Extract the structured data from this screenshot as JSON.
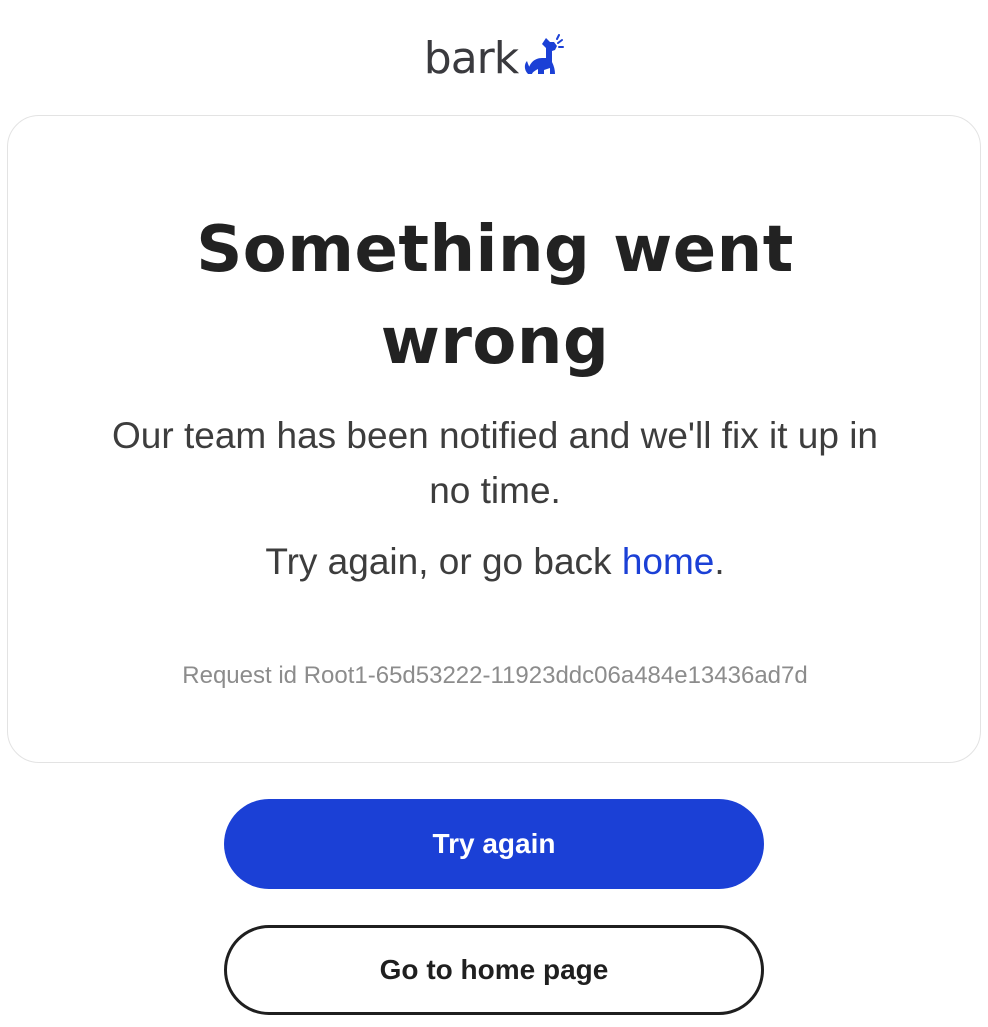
{
  "brand": {
    "name": "bark",
    "logo_icon": "dog-barking-icon",
    "word_color": "#3a3a3e",
    "icon_color": "#1b40d6"
  },
  "error": {
    "headline_line1": "Something went",
    "headline_line2": "wrong",
    "message": "Our team has been notified and we'll fix it up in no time.",
    "retry_prefix": "Try again, or go back ",
    "home_link": "home",
    "retry_suffix": ".",
    "request_id": "Request id Root1-65d53222-11923ddc06a484e13436ad7d"
  },
  "actions": {
    "try_again_label": "Try again",
    "home_page_label": "Go to home page"
  },
  "colors": {
    "accent": "#1b40d6",
    "text": "#222222",
    "muted": "#8c8c8c",
    "card_border": "#e3e3e3"
  }
}
